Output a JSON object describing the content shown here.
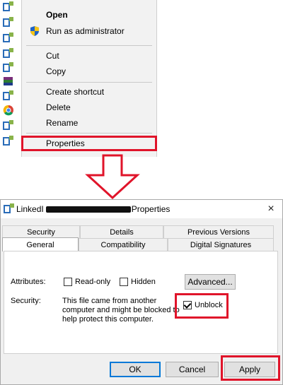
{
  "context_menu": {
    "open": "Open",
    "run_as_admin": "Run as administrator",
    "cut": "Cut",
    "copy": "Copy",
    "create_shortcut": "Create shortcut",
    "delete": "Delete",
    "rename": "Rename",
    "properties": "Properties"
  },
  "dialog": {
    "title_left": "LinkedI",
    "title_right": "Properties",
    "close_icon": "×",
    "tabs_row1": [
      "Security",
      "Details",
      "Previous Versions"
    ],
    "tabs_row2": [
      "General",
      "Compatibility",
      "Digital Signatures"
    ],
    "attributes_label": "Attributes:",
    "readonly_label": "Read-only",
    "hidden_label": "Hidden",
    "advanced_label": "Advanced...",
    "security_label": "Security:",
    "security_text": "This file came from another computer and might be blocked to help protect this computer.",
    "unblock_label": "Unblock",
    "unblock_checked": true,
    "ok_label": "OK",
    "cancel_label": "Cancel",
    "apply_label": "Apply"
  },
  "colors": {
    "highlight": "#e0142a",
    "menu_bg": "#f2f2f2",
    "dialog_bg": "#f0f0f0"
  }
}
